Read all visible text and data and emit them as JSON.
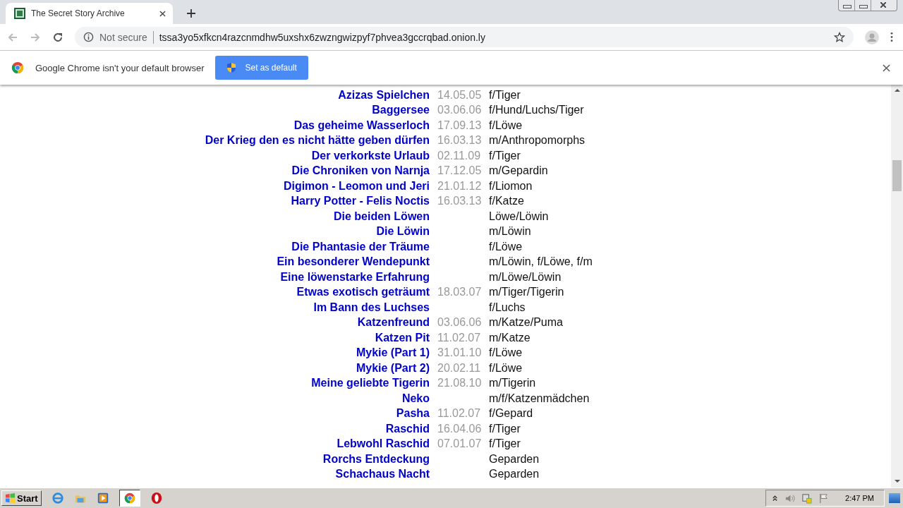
{
  "tabs": [
    {
      "title": "The Secret Story Archive",
      "selected": true
    }
  ],
  "address_bar": {
    "security": "Not secure",
    "url": "tssa3yo5xfkcn4razcnmdhw5uxshx6zwzngwizpyf7phvea3gccrqbad.onion.ly"
  },
  "infobar": {
    "message": "Google Chrome isn't your default browser",
    "button": "Set as default"
  },
  "stories": [
    {
      "title": "Azizas Spielchen",
      "date": "14.05.05",
      "genre": "f/Tiger"
    },
    {
      "title": "Baggersee",
      "date": "03.06.06",
      "genre": "f/Hund/Luchs/Tiger"
    },
    {
      "title": "Das geheime Wasserloch",
      "date": "17.09.13",
      "genre": "f/Löwe"
    },
    {
      "title": "Der Krieg den es nicht hätte geben dürfen",
      "date": "16.03.13",
      "genre": "m/Anthropomorphs"
    },
    {
      "title": "Der verkorkste Urlaub",
      "date": "02.11.09",
      "genre": "f/Tiger"
    },
    {
      "title": "Die Chroniken von Narnja",
      "date": "17.12.05",
      "genre": "m/Gepardin"
    },
    {
      "title": "Digimon - Leomon und Jeri",
      "date": "21.01.12",
      "genre": "f/Liomon"
    },
    {
      "title": "Harry Potter - Felis Noctis",
      "date": "16.03.13",
      "genre": "f/Katze"
    },
    {
      "title": "Die beiden Löwen",
      "genre": "Löwe/Löwin"
    },
    {
      "title": "Die Löwin",
      "genre": "m/Löwin"
    },
    {
      "title": "Die Phantasie der Träume",
      "genre": "f/Löwe"
    },
    {
      "title": "Ein besonderer Wendepunkt",
      "genre": "m/Löwin, f/Löwe, f/m"
    },
    {
      "title": "Eine löwenstarke Erfahrung",
      "genre": "m/Löwe/Löwin"
    },
    {
      "title": "Etwas exotisch geträumt",
      "date": "18.03.07",
      "genre": "m/Tiger/Tigerin"
    },
    {
      "title": "Im Bann des Luchses",
      "genre": "f/Luchs"
    },
    {
      "title": "Katzenfreund",
      "date": "03.06.06",
      "genre": "m/Katze/Puma"
    },
    {
      "title": "Katzen Pit",
      "date": "11.02.07",
      "genre": "m/Katze"
    },
    {
      "title": "Mykie (Part 1)",
      "date": "31.01.10",
      "genre": "f/Löwe"
    },
    {
      "title": "Mykie (Part 2)",
      "date": "20.02.11",
      "genre": "f/Löwe"
    },
    {
      "title": "Meine geliebte Tigerin",
      "date": "21.08.10",
      "genre": "m/Tigerin"
    },
    {
      "title": "Neko",
      "genre": "m/f/Katzenmädchen"
    },
    {
      "title": "Pasha",
      "date": "11.02.07",
      "genre": "f/Gepard"
    },
    {
      "title": "Raschid",
      "date": "16.04.06",
      "genre": "f/Tiger"
    },
    {
      "title": "Lebwohl Raschid",
      "date": "07.01.07",
      "genre": "f/Tiger"
    },
    {
      "title": "Rorchs Entdeckung",
      "genre": "Geparden"
    },
    {
      "title": "Schachaus Nacht",
      "genre": "Geparden"
    }
  ],
  "taskbar": {
    "start": "Start",
    "clock": "2:47 PM"
  }
}
